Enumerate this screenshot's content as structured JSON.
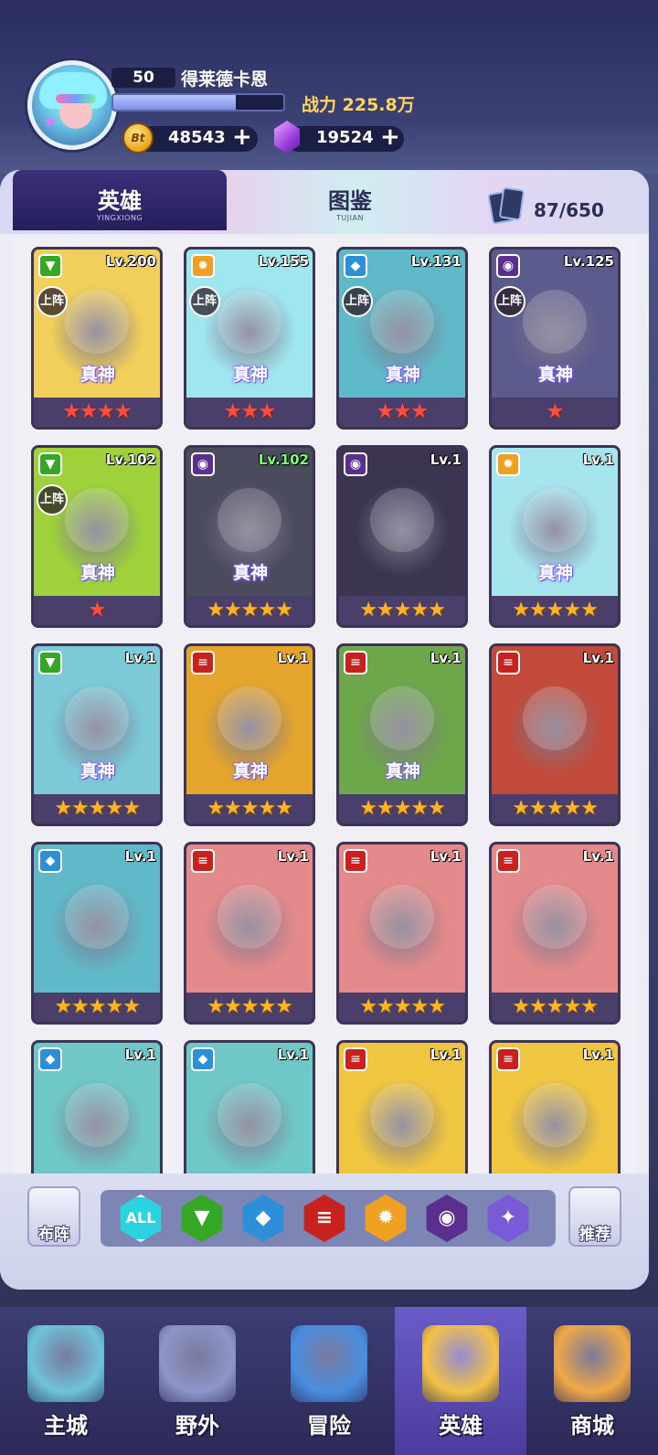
{
  "player": {
    "level": "50",
    "name": "得莱德卡恩",
    "exp_progress": 0.72,
    "power_label": "战力",
    "power_value": "225.8万",
    "gold": "48543",
    "gold_icon_text": "Bt",
    "gems": "19524",
    "plus": "+"
  },
  "tabs": [
    {
      "label": "英雄",
      "sub": "YINGXIONG"
    },
    {
      "label": "图鉴",
      "sub": "TUJIAN"
    }
  ],
  "collection_count": "87/650",
  "heroes": [
    {
      "level": "Lv.200",
      "element": "nature",
      "on_field": "上阵",
      "tier": "真神",
      "stars": "★★★★",
      "star_color": "red",
      "bg": "#f2cf5a"
    },
    {
      "level": "Lv.155",
      "element": "light",
      "on_field": "上阵",
      "tier": "真神",
      "stars": "★★★",
      "star_color": "red",
      "bg": "#9fe6ee"
    },
    {
      "level": "Lv.131",
      "element": "water",
      "on_field": "上阵",
      "tier": "真神",
      "stars": "★★★",
      "star_color": "red",
      "bg": "#5fb9c8"
    },
    {
      "level": "Lv.125",
      "element": "dark",
      "on_field": "上阵",
      "tier": "真神",
      "stars": "★",
      "star_color": "red",
      "bg": "#5b5a8c"
    },
    {
      "level": "Lv.102",
      "element": "nature",
      "on_field": "上阵",
      "tier": "真神",
      "stars": "★",
      "star_color": "red",
      "bg": "#9fd23a"
    },
    {
      "level": "Lv.102",
      "element": "dark",
      "on_field": "",
      "tier": "真神",
      "stars": "★★★★★",
      "star_color": "gold",
      "bg": "#4b4b5e",
      "level_green": true
    },
    {
      "level": "Lv.1",
      "element": "dark",
      "on_field": "",
      "tier": "",
      "stars": "★★★★★",
      "star_color": "gold",
      "bg": "#3b3552"
    },
    {
      "level": "Lv.1",
      "element": "light",
      "on_field": "",
      "tier": "真神",
      "stars": "★★★★★",
      "star_color": "gold",
      "bg": "#a6e4ee"
    },
    {
      "level": "Lv.1",
      "element": "nature",
      "on_field": "",
      "tier": "真神",
      "stars": "★★★★★",
      "star_color": "gold",
      "bg": "#7cc9d8"
    },
    {
      "level": "Lv.1",
      "element": "fire",
      "on_field": "",
      "tier": "真神",
      "stars": "★★★★★",
      "star_color": "gold",
      "bg": "#e3a52c"
    },
    {
      "level": "Lv.1",
      "element": "fire",
      "on_field": "",
      "tier": "真神",
      "stars": "★★★★★",
      "star_color": "gold",
      "bg": "#6ea64a"
    },
    {
      "level": "Lv.1",
      "element": "fire",
      "on_field": "",
      "tier": "",
      "stars": "★★★★★",
      "star_color": "gold",
      "bg": "#c24a3a"
    },
    {
      "level": "Lv.1",
      "element": "water",
      "on_field": "",
      "tier": "",
      "stars": "★★★★★",
      "star_color": "gold",
      "bg": "#5fb9c8"
    },
    {
      "level": "Lv.1",
      "element": "fire",
      "on_field": "",
      "tier": "",
      "stars": "★★★★★",
      "star_color": "gold",
      "bg": "#e58a8a"
    },
    {
      "level": "Lv.1",
      "element": "fire",
      "on_field": "",
      "tier": "",
      "stars": "★★★★★",
      "star_color": "gold",
      "bg": "#e58a8a"
    },
    {
      "level": "Lv.1",
      "element": "fire",
      "on_field": "",
      "tier": "",
      "stars": "★★★★★",
      "star_color": "gold",
      "bg": "#e58a8a"
    },
    {
      "level": "Lv.1",
      "element": "water",
      "on_field": "",
      "tier": "",
      "stars": "",
      "star_color": "gold",
      "bg": "#6fc7c7"
    },
    {
      "level": "Lv.1",
      "element": "water",
      "on_field": "",
      "tier": "",
      "stars": "",
      "star_color": "gold",
      "bg": "#6fc7c7"
    },
    {
      "level": "Lv.1",
      "element": "fire",
      "on_field": "",
      "tier": "",
      "stars": "",
      "star_color": "gold",
      "bg": "#f0c640"
    },
    {
      "level": "Lv.1",
      "element": "fire",
      "on_field": "",
      "tier": "",
      "stars": "",
      "star_color": "gold",
      "bg": "#f0c640"
    }
  ],
  "filters": {
    "left_label": "布阵",
    "right_label": "推荐",
    "all_label": "ALL",
    "elements": [
      "nature",
      "water",
      "fire",
      "light",
      "dark",
      "arcane"
    ]
  },
  "element_colors": {
    "nature": "#34a824",
    "water": "#2c8fd8",
    "fire": "#c8221e",
    "light": "#f0a020",
    "dark": "#5a2f8e",
    "arcane": "#7a5ad6",
    "all": "#2bd3e0"
  },
  "element_glyphs": {
    "nature": "▼",
    "water": "◆",
    "fire": "≡",
    "light": "✹",
    "dark": "◉",
    "arcane": "✦"
  },
  "nav": [
    {
      "label": "主城",
      "icon": "city-icon"
    },
    {
      "label": "野外",
      "icon": "field-icon"
    },
    {
      "label": "冒险",
      "icon": "adventure-icon"
    },
    {
      "label": "英雄",
      "icon": "hero-icon",
      "active": true
    },
    {
      "label": "商城",
      "icon": "shop-icon"
    }
  ]
}
